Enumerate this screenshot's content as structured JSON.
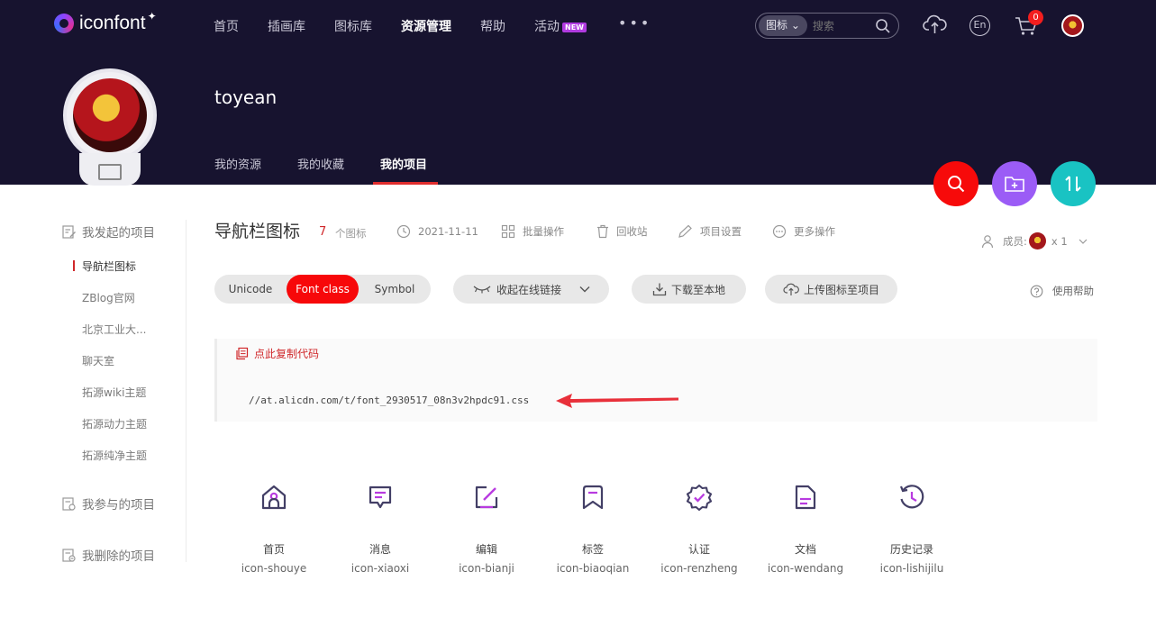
{
  "brand": {
    "name": "iconfont"
  },
  "topnav": {
    "items": [
      "首页",
      "插画库",
      "图标库",
      "资源管理",
      "帮助",
      "活动"
    ],
    "new_badge": "NEW",
    "more": "•••"
  },
  "search": {
    "type": "图标",
    "placeholder": "搜索"
  },
  "cart": {
    "count": "0"
  },
  "lang": "En",
  "profile": {
    "username": "toyean",
    "tabs": [
      "我的资源",
      "我的收藏",
      "我的项目"
    ]
  },
  "sidebar": {
    "group_started": "我发起的项目",
    "projects": [
      "导航栏图标",
      "ZBlog官网",
      "北京工业大...",
      "聊天室",
      "拓源wiki主题",
      "拓源动力主题",
      "拓源纯净主题"
    ],
    "group_joined": "我参与的项目",
    "group_deleted": "我删除的项目"
  },
  "project": {
    "title": "导航栏图标",
    "count": "7",
    "count_label": "个图标",
    "date": "2021-11-11",
    "batch": "批量操作",
    "recycle": "回收站",
    "settings": "项目设置",
    "more": "更多操作",
    "members_label": "成员:",
    "members_count": "x 1"
  },
  "toolbar": {
    "modes": [
      "Unicode",
      "Font class",
      "Symbol"
    ],
    "collapse_link": "收起在线链接",
    "download": "下载至本地",
    "upload": "上传图标至项目",
    "help": "使用帮助"
  },
  "code": {
    "copy": "点此复制代码",
    "url": "//at.alicdn.com/t/font_2930517_08n3v2hpdc91.css"
  },
  "icons": [
    {
      "name": "首页",
      "class": "icon-shouye",
      "glyph": "home-icon"
    },
    {
      "name": "消息",
      "class": "icon-xiaoxi",
      "glyph": "message-icon"
    },
    {
      "name": "编辑",
      "class": "icon-bianji",
      "glyph": "edit-icon"
    },
    {
      "name": "标签",
      "class": "icon-biaoqian",
      "glyph": "tag-icon"
    },
    {
      "name": "认证",
      "class": "icon-renzheng",
      "glyph": "verified-icon"
    },
    {
      "name": "文档",
      "class": "icon-wendang",
      "glyph": "document-icon"
    },
    {
      "name": "历史记录",
      "class": "icon-lishijilu",
      "glyph": "history-icon"
    }
  ],
  "colors": {
    "banner": "#17132f",
    "accent_red": "#f7080a",
    "fab_search": "#f70a0a",
    "fab_folder": "#9b5cf6",
    "fab_transfer": "#19c3c3",
    "icon_stroke": "#433f66",
    "icon_accent": "#b83be0"
  }
}
